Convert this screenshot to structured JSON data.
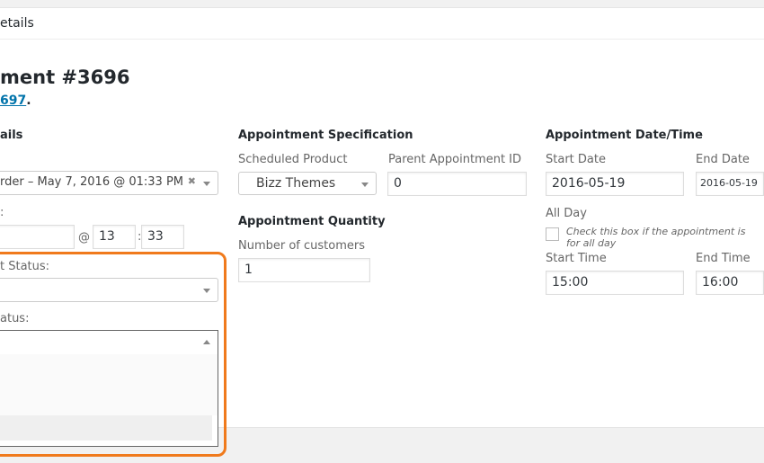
{
  "header": {
    "title": "etails"
  },
  "page": {
    "title": "ment #3696",
    "subtitle_link": "697",
    "subtitle_suffix": "."
  },
  "general": {
    "heading": "ails",
    "order_value": "rder – May 7, 2016 @ 01:33 PM",
    "date_label": ":",
    "hour": "13",
    "minute": "33",
    "at": "@",
    "colon": ":",
    "appt_status_label": "t Status:",
    "order_status_label": "atus:"
  },
  "spec": {
    "heading": "Appointment Specification",
    "product_label": "Scheduled Product",
    "product_value": "Bizz Themes",
    "parent_label": "Parent Appointment ID",
    "parent_value": "0",
    "qty_heading": "Appointment Quantity",
    "customers_label": "Number of customers",
    "customers_value": "1"
  },
  "datetime": {
    "heading": "Appointment Date/Time",
    "start_date_label": "Start Date",
    "start_date": "2016-05-19",
    "end_date_label": "End Date",
    "end_date": "2016-05-19",
    "allday_label": "All Day",
    "allday_text": "Check this box if the appointment is for all day",
    "start_time_label": "Start Time",
    "start_time": "15:00",
    "end_time_label": "End Time",
    "end_time": "16:00"
  },
  "highlight_color": "#f07a1c"
}
